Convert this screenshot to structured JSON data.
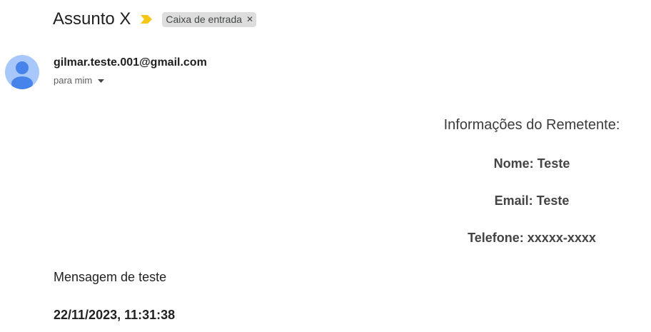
{
  "email": {
    "subject": "Assunto X",
    "label": "Caixa de entrada",
    "label_remove_icon": "close-icon",
    "importance_icon": "importance-marker-icon",
    "importance_color": "#f5c518",
    "sender_email": "gilmar.teste.001@gmail.com",
    "recipient_text": "para mim",
    "avatar_icon": "person-icon",
    "avatar_bg_color": "#a8c7fa",
    "avatar_fg_color": "#4683ea"
  },
  "body": {
    "info_title": "Informações do Remetente:",
    "name_line": "Nome: Teste",
    "email_line": "Email: Teste",
    "phone_line": "Telefone: xxxxx-xxxx",
    "message": "Mensagem de teste",
    "timestamp": "22/11/2023, 11:31:38"
  }
}
